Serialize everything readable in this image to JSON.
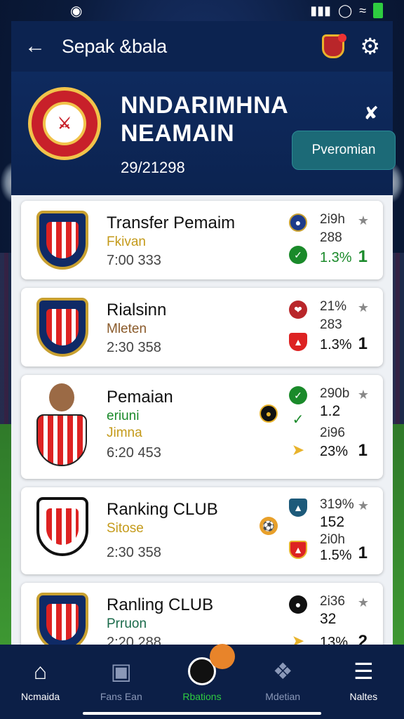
{
  "app": {
    "title": "Sepak &bala"
  },
  "hero": {
    "title_line1": "NNDARIMHNA",
    "title_line2": "NEAMAIN",
    "date": "29/21298",
    "button_label": "Pveromian"
  },
  "cards": [
    {
      "title": "Transfer Pemaim",
      "sub": "Fkivan",
      "time": "7:00 333",
      "stat1": "2i9h",
      "stat2": "288",
      "pct": "1.3%",
      "rank": "1",
      "rank_color": "#1a8a2a"
    },
    {
      "title": "Rialsinn",
      "sub": "Mleten",
      "time": "2:30 358",
      "stat1": "21%",
      "stat2": "283",
      "pct": "1.3%",
      "rank": "1"
    },
    {
      "title": "Pemaian",
      "sub": "eriuni",
      "sub2": "Jimna",
      "time": "6:20 453",
      "stat1": "290b",
      "stat2": "1.2",
      "stat3": "2i96",
      "pct": "23%",
      "rank": "1"
    },
    {
      "title": "Ranking CLUB",
      "sub": "Sitose",
      "time": "2:30 358",
      "stat1": "319%",
      "stat2": "152",
      "stat3": "2i0h",
      "pct": "1.5%",
      "rank": "1"
    },
    {
      "title": "Ranling CLUB",
      "sub": "Prruon",
      "time": "2:20 288",
      "stat1": "2i36",
      "stat2": "32",
      "pct": "13%",
      "rank": "2"
    }
  ],
  "nav": [
    {
      "label": "Ncmaida"
    },
    {
      "label": "Fans Ean"
    },
    {
      "label": "Rbations"
    },
    {
      "label": "Mdetian"
    },
    {
      "label": "Naltes"
    }
  ],
  "colors": {
    "primary": "#0c2350",
    "accent_green": "#2ecc40",
    "button_teal": "#1c6a77"
  }
}
